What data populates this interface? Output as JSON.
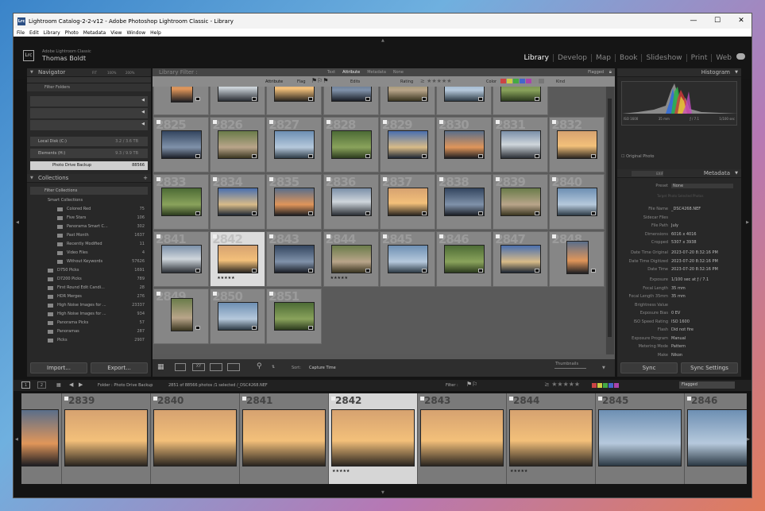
{
  "window": {
    "title": "Lightroom Catalog-2-2-v12 - Adobe Photoshop Lightroom Classic - Library",
    "min": "—",
    "max": "☐",
    "close": "✕",
    "app_icon": "Lrc"
  },
  "menu": [
    "File",
    "Edit",
    "Library",
    "Photo",
    "Metadata",
    "View",
    "Window",
    "Help"
  ],
  "identity": {
    "logo": "Lrc",
    "line1": "Adobe Lightroom Classic",
    "line2": "Thomas Boldt"
  },
  "modules": [
    "Library",
    "Develop",
    "Map",
    "Book",
    "Slideshow",
    "Print",
    "Web"
  ],
  "navigator": {
    "title": "Navigator",
    "fit": "FIT",
    "z1": "100%",
    "z2": "200%"
  },
  "folders": {
    "filter": "Filter Folders",
    "volumes": [
      {
        "name": "Local Disk (C:)",
        "size": "3.2 / 3.6 TB"
      },
      {
        "name": "Elements (H:)",
        "size": "9.3 / 9.9 TB"
      }
    ],
    "folder": {
      "name": "Photo Drive Backup",
      "count": "88566"
    }
  },
  "collections": {
    "title": "Collections",
    "filter": "Filter Collections",
    "smart": "Smart Collections",
    "items": [
      {
        "name": "Colored Red",
        "count": "75"
      },
      {
        "name": "Five Stars",
        "count": "106"
      },
      {
        "name": "Panorama Smart C...",
        "count": "302"
      },
      {
        "name": "Past Month",
        "count": "1637"
      },
      {
        "name": "Recently Modified",
        "count": "11"
      },
      {
        "name": "Video Files",
        "count": "4"
      },
      {
        "name": "Without Keywords",
        "count": "57626"
      },
      {
        "name": "D750 Picks",
        "count": "1691"
      },
      {
        "name": "D7200 Picks",
        "count": "789"
      },
      {
        "name": "First Round Edit Candi...",
        "count": "28"
      },
      {
        "name": "HDR Merges",
        "count": "276"
      },
      {
        "name": "High Noise Images for ...",
        "count": "23337"
      },
      {
        "name": "High Noise Images for ...",
        "count": "934"
      },
      {
        "name": "Panorama Picks",
        "count": "57"
      },
      {
        "name": "Panoramas",
        "count": "287"
      },
      {
        "name": "Picks",
        "count": "2907"
      }
    ]
  },
  "buttons": {
    "import": "Import...",
    "export": "Export...",
    "sync": "Sync",
    "sync_settings": "Sync Settings"
  },
  "filter_bar": {
    "title": "Library Filter :",
    "tabs": [
      "Text",
      "Attribute",
      "Metadata",
      "None"
    ],
    "active": "Attribute",
    "flagged": "Flagged"
  },
  "attr_bar": {
    "attribute": "Attribute",
    "flag": "Flag",
    "edits": "Edits",
    "rating": "Rating",
    "color": "Color",
    "kind": "Kind"
  },
  "grid": {
    "rows": [
      [
        "",
        "",
        "",
        "",
        "",
        "",
        ""
      ],
      [
        "2825",
        "2826",
        "2827",
        "2828",
        "2829",
        "2830",
        "2831",
        "2832"
      ],
      [
        "2833",
        "2834",
        "2835",
        "2836",
        "2837",
        "2838",
        "2839",
        "2840"
      ],
      [
        "2841",
        "2842",
        "2843",
        "2844",
        "2845",
        "2846",
        "2847",
        "2848"
      ],
      [
        "2849",
        "2850",
        "2851"
      ]
    ]
  },
  "toolbar": {
    "sort_label": "Sort:",
    "sort_value": "Capture Time",
    "thumbs": "Thumbnails"
  },
  "histogram": {
    "title": "Histogram",
    "iso": "ISO 1600",
    "focal": "35 mm",
    "aperture": "ƒ / 7.1",
    "shutter": "1/100 sec",
    "original": "Original Photo"
  },
  "metadata": {
    "title": "Metadata",
    "preset_label": "Preset",
    "preset": "None",
    "target": "Target Photo",
    "selected": "Selected Photos",
    "exif": "EXIF",
    "rows": [
      {
        "l": "File Name",
        "v": "_DSC4268.NEF"
      },
      {
        "l": "Sidecar Files",
        "v": ""
      },
      {
        "l": "File Path",
        "v": "July"
      },
      {
        "l": "Dimensions",
        "v": "6016 x 4016"
      },
      {
        "l": "Cropped",
        "v": "5307 x 3938"
      },
      {
        "l": "Date Time Original",
        "v": "2023-07-20 8:32:16 PM"
      },
      {
        "l": "Date Time Digitized",
        "v": "2023-07-20 8:32:16 PM"
      },
      {
        "l": "Date Time",
        "v": "2023-07-20 8:32:16 PM"
      },
      {
        "l": "Exposure",
        "v": "1/100 sec at ƒ / 7.1"
      },
      {
        "l": "Focal Length",
        "v": "35 mm"
      },
      {
        "l": "Focal Length 35mm",
        "v": "35 mm"
      },
      {
        "l": "Brightness Value",
        "v": ""
      },
      {
        "l": "Exposure Bias",
        "v": "0 EV"
      },
      {
        "l": "ISO Speed Rating",
        "v": "ISO 1600"
      },
      {
        "l": "Flash",
        "v": "Did not fire"
      },
      {
        "l": "Exposure Program",
        "v": "Manual"
      },
      {
        "l": "Metering Mode",
        "v": "Pattern"
      },
      {
        "l": "Make",
        "v": "Nikon"
      }
    ]
  },
  "filmstrip_bar": {
    "folder": "Folder : Photo Drive Backup",
    "count": "2851 of 88566 photos /1 selected /_DSC4268.NEF",
    "filter": "Filter :",
    "flagged": "Flagged",
    "views": [
      "1",
      "2"
    ]
  },
  "filmstrip": [
    "",
    "2839",
    "2840",
    "2841",
    "2842",
    "2843",
    "2844",
    "2845",
    "2846"
  ],
  "colors": {
    "accent": "#dcdcdc",
    "panel": "#282828",
    "grid": "#868686"
  }
}
